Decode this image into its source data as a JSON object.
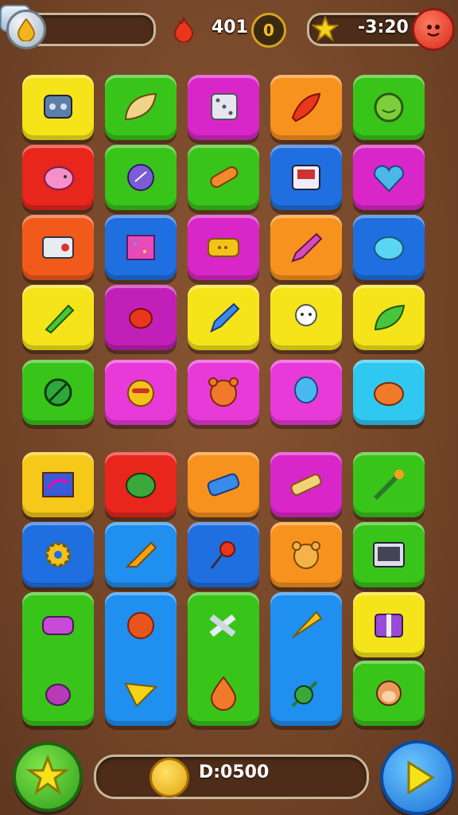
{
  "hud": {
    "lives_icon": "drop-icon",
    "add_label": "+",
    "fire_icon": "flame-icon",
    "score": "401",
    "coin_symbol": "0",
    "timer": "-3:20",
    "star_icon": "star-icon",
    "avatar_icon": "red-face-icon"
  },
  "board": {
    "tiles": [
      {
        "row": 0,
        "col": 0,
        "color": "#f5e41a",
        "icon": "robot-icon"
      },
      {
        "row": 0,
        "col": 1,
        "color": "#39c41a",
        "icon": "leaf-icon"
      },
      {
        "row": 0,
        "col": 2,
        "color": "#d926c8",
        "icon": "dice-icon"
      },
      {
        "row": 0,
        "col": 3,
        "color": "#f7921e",
        "icon": "chili-icon"
      },
      {
        "row": 0,
        "col": 4,
        "color": "#39c41a",
        "icon": "smile-coin-icon"
      },
      {
        "row": 1,
        "col": 0,
        "color": "#e8261c",
        "icon": "pig-icon"
      },
      {
        "row": 1,
        "col": 1,
        "color": "#39c41a",
        "icon": "bag-icon"
      },
      {
        "row": 1,
        "col": 2,
        "color": "#39c41a",
        "icon": "tube-icon"
      },
      {
        "row": 1,
        "col": 3,
        "color": "#1f6fe0",
        "icon": "radio-icon"
      },
      {
        "row": 1,
        "col": 4,
        "color": "#d926c8",
        "icon": "heart-icon"
      },
      {
        "row": 2,
        "col": 0,
        "color": "#f25a1c",
        "icon": "switch-icon"
      },
      {
        "row": 2,
        "col": 1,
        "color": "#1f6fe0",
        "icon": "carpet-icon"
      },
      {
        "row": 2,
        "col": 2,
        "color": "#d926c8",
        "icon": "tag-icon"
      },
      {
        "row": 2,
        "col": 3,
        "color": "#f7921e",
        "icon": "crayon-icon"
      },
      {
        "row": 2,
        "col": 4,
        "color": "#1f6fe0",
        "icon": "blob-icon"
      },
      {
        "row": 3,
        "col": 0,
        "color": "#f5e41a",
        "icon": "rocket-icon"
      },
      {
        "row": 3,
        "col": 1,
        "color": "#c21fb8",
        "icon": "candy-icon"
      },
      {
        "row": 3,
        "col": 2,
        "color": "#f5e41a",
        "icon": "pen-icon"
      },
      {
        "row": 3,
        "col": 3,
        "color": "#f5e41a",
        "icon": "ghost-icon"
      },
      {
        "row": 3,
        "col": 4,
        "color": "#f5e41a",
        "icon": "green-leaf-icon"
      },
      {
        "row": 4,
        "col": 0,
        "color": "#39c41a",
        "icon": "no-sign-icon"
      },
      {
        "row": 4,
        "col": 1,
        "color": "#e83ad8",
        "icon": "cat-face-icon"
      },
      {
        "row": 4,
        "col": 2,
        "color": "#e83ad8",
        "icon": "bear-face-icon"
      },
      {
        "row": 4,
        "col": 3,
        "color": "#e83ad8",
        "icon": "balloon-icon"
      },
      {
        "row": 4,
        "col": 4,
        "color": "#2fc8f0",
        "icon": "pumpkin-icon"
      },
      {
        "row": 5,
        "col": 0,
        "color": "#f5c81a",
        "icon": "map-icon"
      },
      {
        "row": 5,
        "col": 1,
        "color": "#e8261c",
        "icon": "lettuce-icon"
      },
      {
        "row": 5,
        "col": 2,
        "color": "#f7921e",
        "icon": "battery-icon"
      },
      {
        "row": 5,
        "col": 3,
        "color": "#d926c8",
        "icon": "bandage-icon"
      },
      {
        "row": 5,
        "col": 4,
        "color": "#39c41a",
        "icon": "sword-icon"
      },
      {
        "row": 6,
        "col": 0,
        "color": "#1f6fe0",
        "icon": "gear-icon"
      },
      {
        "row": 6,
        "col": 1,
        "color": "#1f8ff0",
        "icon": "paint-tube-icon"
      },
      {
        "row": 6,
        "col": 2,
        "color": "#1f6fe0",
        "icon": "lollipop-icon"
      },
      {
        "row": 6,
        "col": 3,
        "color": "#f7921e",
        "icon": "teddy-icon"
      },
      {
        "row": 6,
        "col": 4,
        "color": "#39c41a",
        "icon": "tv-icon"
      },
      {
        "row": 7,
        "col": 0,
        "color": "#39c41a",
        "icon": "mask-icon",
        "span": 2,
        "icon2": "eggplant-icon"
      },
      {
        "row": 7,
        "col": 1,
        "color": "#1f8ff0",
        "icon": "ball-icon",
        "span": 2,
        "icon2": "cheese-icon"
      },
      {
        "row": 7,
        "col": 2,
        "color": "#39c41a",
        "icon": "bone-icon",
        "span": 2,
        "icon2": "drop-orange-icon"
      },
      {
        "row": 7,
        "col": 3,
        "color": "#1f8ff0",
        "icon": "cone-icon",
        "span": 2,
        "icon2": "plant-icon"
      },
      {
        "row": 7,
        "col": 4,
        "color": "#f5e41a",
        "icon": "gift-box-icon"
      },
      {
        "row": 8,
        "col": 4,
        "color": "#39c41a",
        "icon": "monkey-icon"
      }
    ]
  },
  "footer": {
    "star_button_icon": "star-icon",
    "coin_icon": "coin-icon",
    "score": "D:0500",
    "play_button_icon": "play-icon"
  }
}
